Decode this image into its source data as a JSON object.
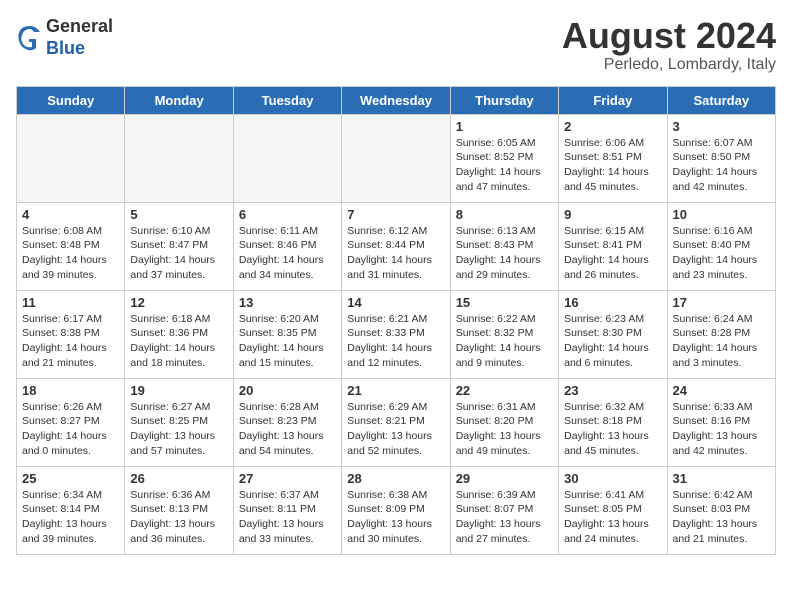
{
  "header": {
    "logo_line1": "General",
    "logo_line2": "Blue",
    "month_year": "August 2024",
    "location": "Perledo, Lombardy, Italy"
  },
  "weekdays": [
    "Sunday",
    "Monday",
    "Tuesday",
    "Wednesday",
    "Thursday",
    "Friday",
    "Saturday"
  ],
  "weeks": [
    [
      {
        "day": "",
        "info": ""
      },
      {
        "day": "",
        "info": ""
      },
      {
        "day": "",
        "info": ""
      },
      {
        "day": "",
        "info": ""
      },
      {
        "day": "1",
        "info": "Sunrise: 6:05 AM\nSunset: 8:52 PM\nDaylight: 14 hours\nand 47 minutes."
      },
      {
        "day": "2",
        "info": "Sunrise: 6:06 AM\nSunset: 8:51 PM\nDaylight: 14 hours\nand 45 minutes."
      },
      {
        "day": "3",
        "info": "Sunrise: 6:07 AM\nSunset: 8:50 PM\nDaylight: 14 hours\nand 42 minutes."
      }
    ],
    [
      {
        "day": "4",
        "info": "Sunrise: 6:08 AM\nSunset: 8:48 PM\nDaylight: 14 hours\nand 39 minutes."
      },
      {
        "day": "5",
        "info": "Sunrise: 6:10 AM\nSunset: 8:47 PM\nDaylight: 14 hours\nand 37 minutes."
      },
      {
        "day": "6",
        "info": "Sunrise: 6:11 AM\nSunset: 8:46 PM\nDaylight: 14 hours\nand 34 minutes."
      },
      {
        "day": "7",
        "info": "Sunrise: 6:12 AM\nSunset: 8:44 PM\nDaylight: 14 hours\nand 31 minutes."
      },
      {
        "day": "8",
        "info": "Sunrise: 6:13 AM\nSunset: 8:43 PM\nDaylight: 14 hours\nand 29 minutes."
      },
      {
        "day": "9",
        "info": "Sunrise: 6:15 AM\nSunset: 8:41 PM\nDaylight: 14 hours\nand 26 minutes."
      },
      {
        "day": "10",
        "info": "Sunrise: 6:16 AM\nSunset: 8:40 PM\nDaylight: 14 hours\nand 23 minutes."
      }
    ],
    [
      {
        "day": "11",
        "info": "Sunrise: 6:17 AM\nSunset: 8:38 PM\nDaylight: 14 hours\nand 21 minutes."
      },
      {
        "day": "12",
        "info": "Sunrise: 6:18 AM\nSunset: 8:36 PM\nDaylight: 14 hours\nand 18 minutes."
      },
      {
        "day": "13",
        "info": "Sunrise: 6:20 AM\nSunset: 8:35 PM\nDaylight: 14 hours\nand 15 minutes."
      },
      {
        "day": "14",
        "info": "Sunrise: 6:21 AM\nSunset: 8:33 PM\nDaylight: 14 hours\nand 12 minutes."
      },
      {
        "day": "15",
        "info": "Sunrise: 6:22 AM\nSunset: 8:32 PM\nDaylight: 14 hours\nand 9 minutes."
      },
      {
        "day": "16",
        "info": "Sunrise: 6:23 AM\nSunset: 8:30 PM\nDaylight: 14 hours\nand 6 minutes."
      },
      {
        "day": "17",
        "info": "Sunrise: 6:24 AM\nSunset: 8:28 PM\nDaylight: 14 hours\nand 3 minutes."
      }
    ],
    [
      {
        "day": "18",
        "info": "Sunrise: 6:26 AM\nSunset: 8:27 PM\nDaylight: 14 hours\nand 0 minutes."
      },
      {
        "day": "19",
        "info": "Sunrise: 6:27 AM\nSunset: 8:25 PM\nDaylight: 13 hours\nand 57 minutes."
      },
      {
        "day": "20",
        "info": "Sunrise: 6:28 AM\nSunset: 8:23 PM\nDaylight: 13 hours\nand 54 minutes."
      },
      {
        "day": "21",
        "info": "Sunrise: 6:29 AM\nSunset: 8:21 PM\nDaylight: 13 hours\nand 52 minutes."
      },
      {
        "day": "22",
        "info": "Sunrise: 6:31 AM\nSunset: 8:20 PM\nDaylight: 13 hours\nand 49 minutes."
      },
      {
        "day": "23",
        "info": "Sunrise: 6:32 AM\nSunset: 8:18 PM\nDaylight: 13 hours\nand 45 minutes."
      },
      {
        "day": "24",
        "info": "Sunrise: 6:33 AM\nSunset: 8:16 PM\nDaylight: 13 hours\nand 42 minutes."
      }
    ],
    [
      {
        "day": "25",
        "info": "Sunrise: 6:34 AM\nSunset: 8:14 PM\nDaylight: 13 hours\nand 39 minutes."
      },
      {
        "day": "26",
        "info": "Sunrise: 6:36 AM\nSunset: 8:13 PM\nDaylight: 13 hours\nand 36 minutes."
      },
      {
        "day": "27",
        "info": "Sunrise: 6:37 AM\nSunset: 8:11 PM\nDaylight: 13 hours\nand 33 minutes."
      },
      {
        "day": "28",
        "info": "Sunrise: 6:38 AM\nSunset: 8:09 PM\nDaylight: 13 hours\nand 30 minutes."
      },
      {
        "day": "29",
        "info": "Sunrise: 6:39 AM\nSunset: 8:07 PM\nDaylight: 13 hours\nand 27 minutes."
      },
      {
        "day": "30",
        "info": "Sunrise: 6:41 AM\nSunset: 8:05 PM\nDaylight: 13 hours\nand 24 minutes."
      },
      {
        "day": "31",
        "info": "Sunrise: 6:42 AM\nSunset: 8:03 PM\nDaylight: 13 hours\nand 21 minutes."
      }
    ]
  ]
}
